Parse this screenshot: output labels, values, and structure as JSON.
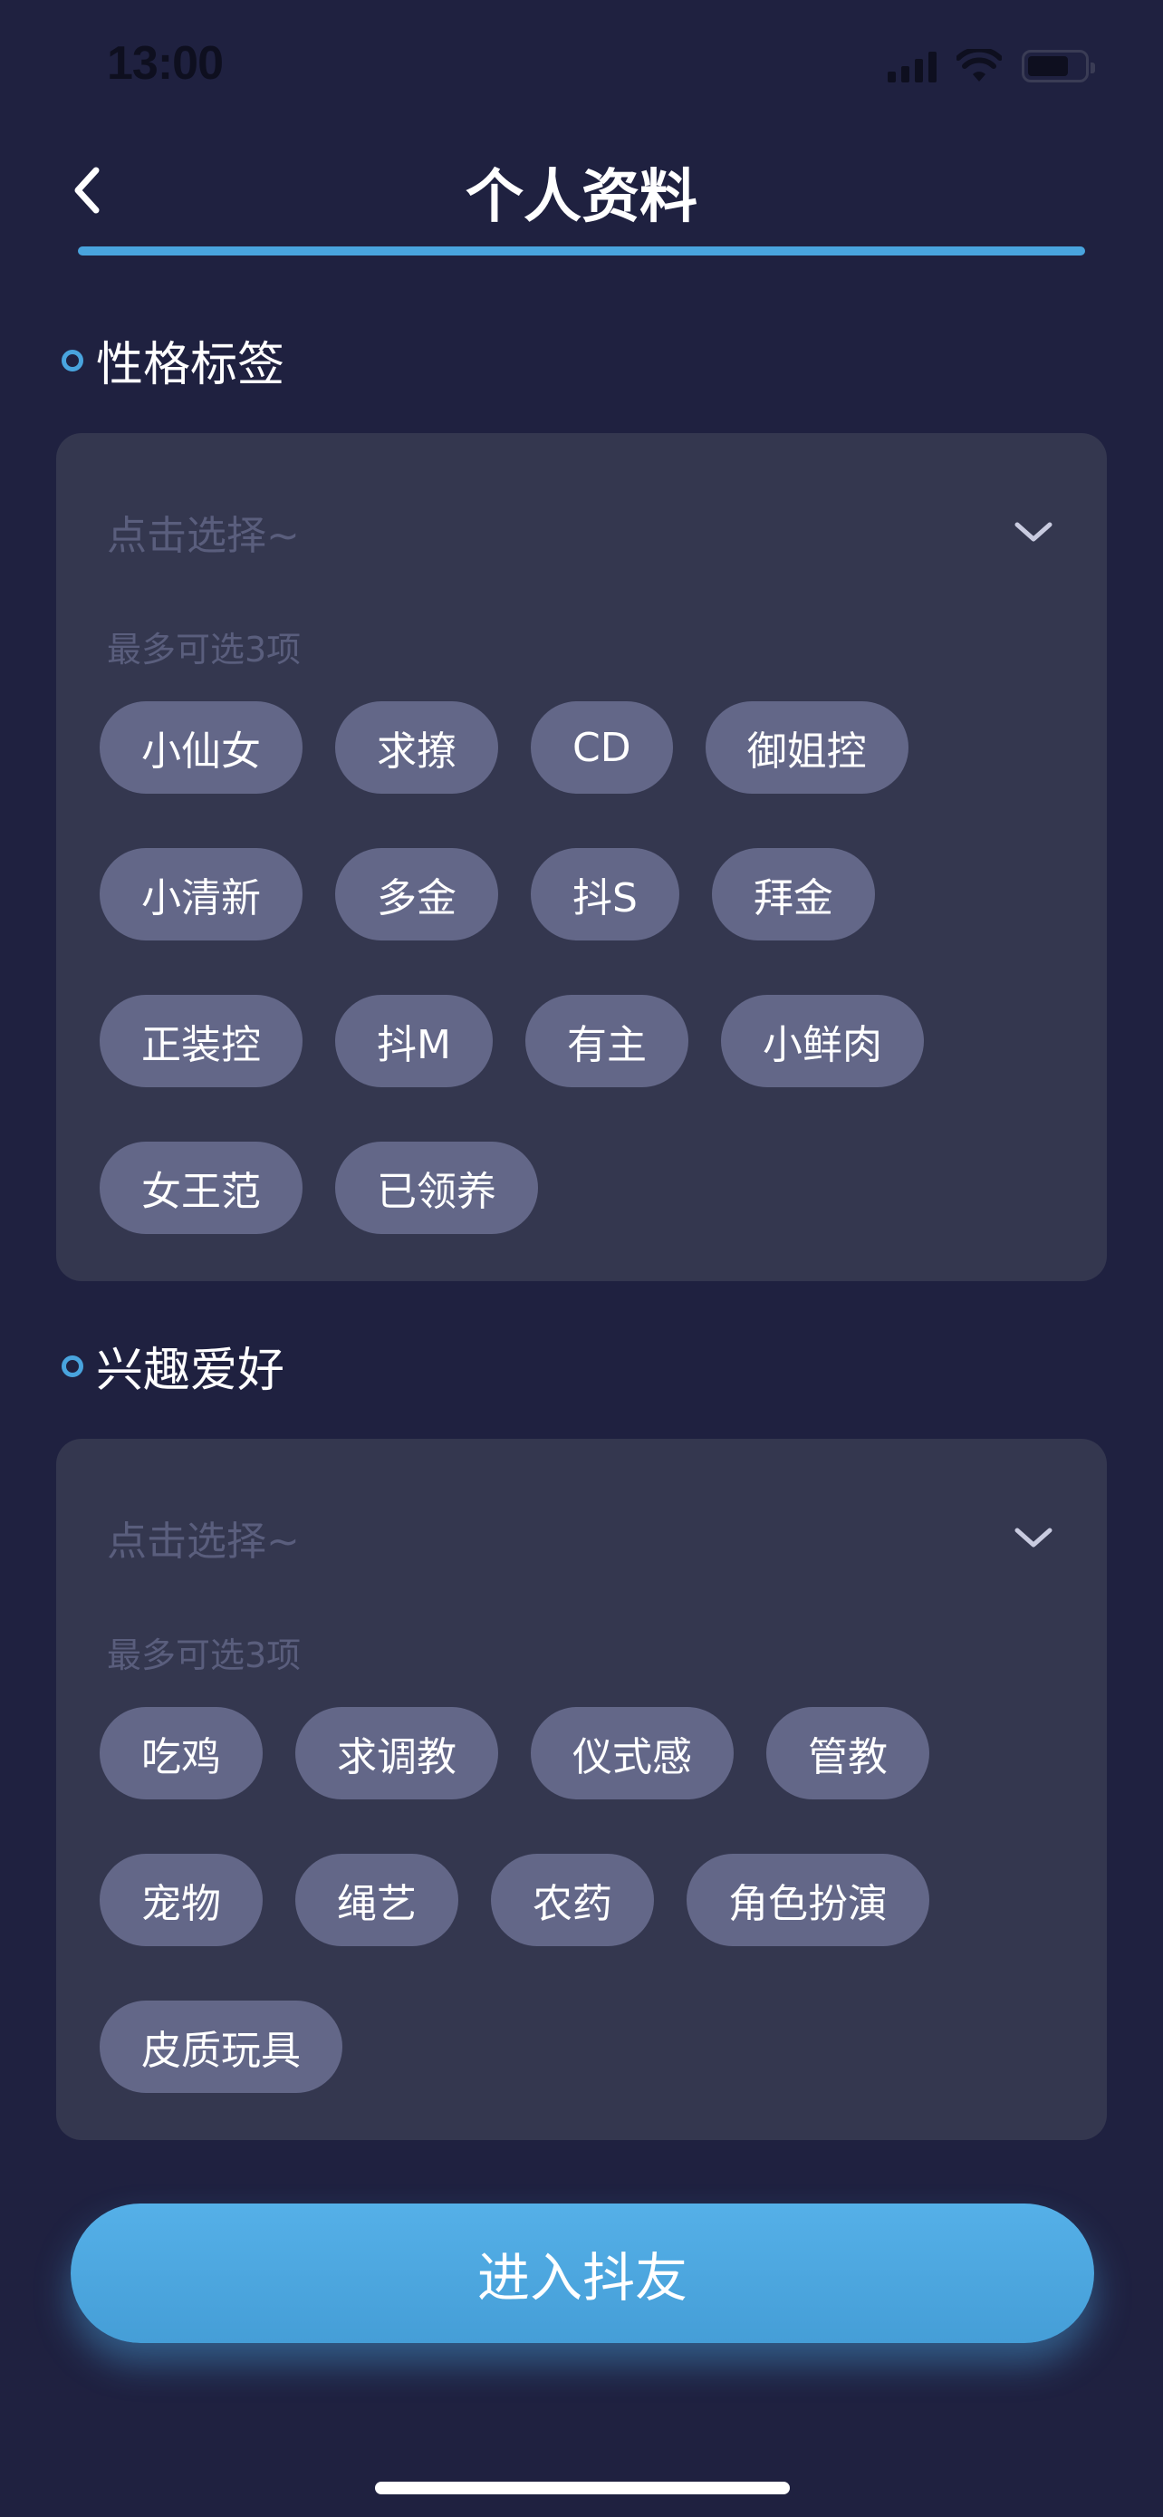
{
  "status_bar": {
    "time": "13:00"
  },
  "nav": {
    "title": "个人资料"
  },
  "personality": {
    "title": "性格标签",
    "placeholder": "点击选择~",
    "hint": "最多可选3项",
    "tags": [
      "小仙女",
      "求撩",
      "CD",
      "御姐控",
      "小清新",
      "多金",
      "抖S",
      "拜金",
      "正装控",
      "抖M",
      "有主",
      "小鲜肉",
      "女王范",
      "已领养"
    ]
  },
  "hobbies": {
    "title": "兴趣爱好",
    "placeholder": "点击选择~",
    "hint": "最多可选3项",
    "tags": [
      "吃鸡",
      "求调教",
      "仪式感",
      "管教",
      "宠物",
      "绳艺",
      "农药",
      "角色扮演",
      "皮质玩具"
    ]
  },
  "enter_button": {
    "label": "进入抖友"
  },
  "colors": {
    "background": "#1f2140",
    "card": "#34374f",
    "tag": "#636788",
    "accent": "#49a4de"
  },
  "icons": {
    "back": "chevron-left-icon",
    "dropdown": "chevron-down-icon"
  }
}
